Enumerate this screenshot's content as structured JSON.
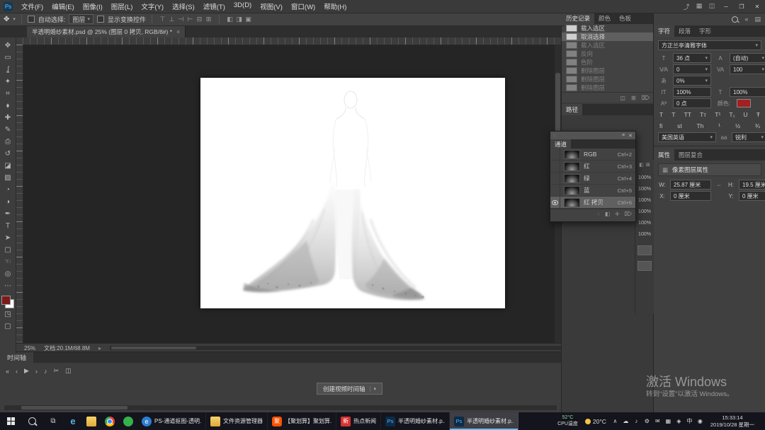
{
  "menubar": {
    "logo": "Ps",
    "menus": [
      "文件(F)",
      "编辑(E)",
      "图像(I)",
      "图层(L)",
      "文字(Y)",
      "选择(S)",
      "滤镜(T)",
      "3D(D)",
      "视图(V)",
      "窗口(W)",
      "帮助(H)"
    ],
    "right_icons": [
      "⤴",
      "▦",
      "◫"
    ],
    "window_controls": [
      "─",
      "❐",
      "✕"
    ]
  },
  "options_bar": {
    "tool_glyph": "✥",
    "dropdown_arrow": "▾",
    "auto_select_label": "自动选择:",
    "auto_select_value": "图层",
    "show_transform_label": "显示变换控件",
    "align_icons": [
      "⊤",
      "⊥",
      "⊣",
      "⊢",
      "⊟",
      "⊞"
    ],
    "mode_icons": [
      "◧",
      "◨",
      "▣"
    ]
  },
  "document_tab": {
    "title": "半透明婚纱素材.psd @ 25% (图层 0 拷贝, RGB/8#) *",
    "close_glyph": "×"
  },
  "toolbar": {
    "tools": [
      {
        "name": "move-tool",
        "glyph": "✥"
      },
      {
        "name": "marquee-tool",
        "glyph": "▭"
      },
      {
        "name": "lasso-tool",
        "glyph": "ʆ"
      },
      {
        "name": "quick-selection-tool",
        "glyph": "✦"
      },
      {
        "name": "crop-tool",
        "glyph": "⌗"
      },
      {
        "name": "eyedropper-tool",
        "glyph": "⬧"
      },
      {
        "name": "healing-brush-tool",
        "glyph": "✚"
      },
      {
        "name": "brush-tool",
        "glyph": "✎"
      },
      {
        "name": "clone-stamp-tool",
        "glyph": "⎙"
      },
      {
        "name": "history-brush-tool",
        "glyph": "↺"
      },
      {
        "name": "eraser-tool",
        "glyph": "◪"
      },
      {
        "name": "gradient-tool",
        "glyph": "▨"
      },
      {
        "name": "blur-tool",
        "glyph": "◔"
      },
      {
        "name": "dodge-tool",
        "glyph": "◑"
      },
      {
        "name": "pen-tool",
        "glyph": "✒"
      },
      {
        "name": "type-tool",
        "glyph": "T"
      },
      {
        "name": "path-selection-tool",
        "glyph": "➤"
      },
      {
        "name": "shape-tool",
        "glyph": "▢"
      },
      {
        "name": "hand-tool",
        "glyph": "☜"
      },
      {
        "name": "zoom-tool",
        "glyph": "◎"
      }
    ],
    "more_glyph": "⋯",
    "foreground_color": "#7a1b1b",
    "background_color": "#ffffff",
    "mask_glyph": "◳",
    "screen_glyph": "▢"
  },
  "history_panel": {
    "tabs": [
      {
        "label": "历史记录",
        "active": true
      },
      {
        "label": "颜色",
        "active": false
      },
      {
        "label": "色板",
        "active": false
      }
    ],
    "entries": [
      {
        "label": "载入选区",
        "dim": false,
        "selected": false
      },
      {
        "label": "取消选择",
        "dim": false,
        "selected": true
      },
      {
        "label": "载入选区",
        "dim": true,
        "selected": false
      },
      {
        "label": "反向",
        "dim": true,
        "selected": false
      },
      {
        "label": "色阶",
        "dim": true,
        "selected": false
      },
      {
        "label": "删除图层",
        "dim": true,
        "selected": false
      },
      {
        "label": "删除图层",
        "dim": true,
        "selected": false
      },
      {
        "label": "删除图层",
        "dim": true,
        "selected": false
      }
    ],
    "footer_icons": [
      "◫",
      "⊞",
      "⌦"
    ]
  },
  "paths_panel": {
    "tab": "路径"
  },
  "channels_panel": {
    "tab": "通道",
    "close_glyph": "✕",
    "rows": [
      {
        "name": "RGB",
        "shortcut": "Ctrl+2",
        "visible": false,
        "selected": false
      },
      {
        "name": "红",
        "shortcut": "Ctrl+3",
        "visible": false,
        "selected": false
      },
      {
        "name": "绿",
        "shortcut": "Ctrl+4",
        "visible": false,
        "selected": false
      },
      {
        "name": "蓝",
        "shortcut": "Ctrl+5",
        "visible": false,
        "selected": false
      },
      {
        "name": "红 拷贝",
        "shortcut": "Ctrl+6",
        "visible": true,
        "selected": true
      }
    ],
    "footer_icons": [
      "◌",
      "◧",
      "✛",
      "⌦"
    ]
  },
  "mini_strip": {
    "header_icons": [
      "◧",
      "⊠"
    ],
    "rows": [
      "100%",
      "100%",
      "100%",
      "100%",
      "100%",
      "100%"
    ]
  },
  "right_dock": {
    "top_icons": [
      "«",
      "▤"
    ]
  },
  "character_panel": {
    "tabs": [
      {
        "label": "字符",
        "active": true
      },
      {
        "label": "段落",
        "active": false
      },
      {
        "label": "字形",
        "active": false
      }
    ],
    "font_name": "方正兰亭清雅字体",
    "dropdown_arrow": "▾",
    "size_icon": "T",
    "size_value": "36 点",
    "leading_icon": "A",
    "leading_value": "(自动)",
    "kerning_icon": "V⁄A",
    "kerning_value": "0",
    "tracking_icon": "VA",
    "tracking_value": "100",
    "proportional_icon": "あ",
    "proportional_value": "0%",
    "vscale_icon": "IT",
    "vscale_value": "100%",
    "hscale_icon": "T",
    "hscale_value": "100%",
    "baseline_icon": "Aª",
    "baseline_value": "0 点",
    "color_label": "颜色:",
    "color_value": "#a32020",
    "style_icons": [
      "T",
      "T",
      "TT",
      "Tᴛ",
      "T¹",
      "T₁",
      "U",
      "Ŧ"
    ],
    "feature_icons": [
      "fi",
      "st",
      "Th",
      "¹",
      "½",
      "¾"
    ],
    "language_value": "美国英语",
    "antialias_label": "aa",
    "antialias_value": "锐利"
  },
  "properties_panel": {
    "tabs": [
      {
        "label": "属性",
        "active": true
      },
      {
        "label": "图层复合",
        "active": false
      }
    ],
    "header_icon": "▦",
    "header": "像素图层属性",
    "w_label": "W:",
    "w_value": "25.87 厘米",
    "link_glyph": "⇔",
    "h_label": "H:",
    "h_value": "19.5 厘米",
    "x_label": "X:",
    "x_value": "0 厘米",
    "y_label": "Y:",
    "y_value": "0 厘米"
  },
  "status_bar": {
    "zoom": "25%",
    "doc_info": "文档:20.1M/68.8M",
    "arrow": "▸"
  },
  "timeline": {
    "tab": "时间轴",
    "controls": [
      "«",
      "‹",
      "▶",
      "›",
      "♪",
      "✂",
      "◫"
    ],
    "create_button": "创建视频时间轴",
    "dropdown_arrow": "▾"
  },
  "watermark": {
    "line1": "激活 Windows",
    "line2": "转到“设置”以激活 Windows。"
  },
  "taskbar": {
    "taskview_glyph": "⧉",
    "pinned": [
      {
        "app": "edge"
      },
      {
        "app": "folder"
      },
      {
        "app": "chrome"
      },
      {
        "app": "wechat"
      }
    ],
    "task_buttons": [
      {
        "app": "web",
        "label": "PS-通道抠图-透明..",
        "active": false
      },
      {
        "app": "folder",
        "label": "文件资源管理器",
        "active": false
      },
      {
        "app": "ju",
        "label": "【聚划算】聚划算..",
        "active": false
      },
      {
        "app": "news",
        "label": "热点新闻",
        "active": false
      },
      {
        "app": "ps",
        "label": "半透明婚纱素材.p..",
        "active": false
      },
      {
        "app": "ps",
        "label": "半透明婚纱素材.p..",
        "active": true
      }
    ],
    "cpu_temp": "52°C",
    "cpu_label": "CPU温度",
    "weather_temp": "20°C",
    "tray_icons": [
      "∧",
      "☁",
      "♪",
      "⚙",
      "✉",
      "▦",
      "◈",
      "中",
      "◉"
    ],
    "time": "15:33:14",
    "date": "2019/10/28 星期一"
  }
}
